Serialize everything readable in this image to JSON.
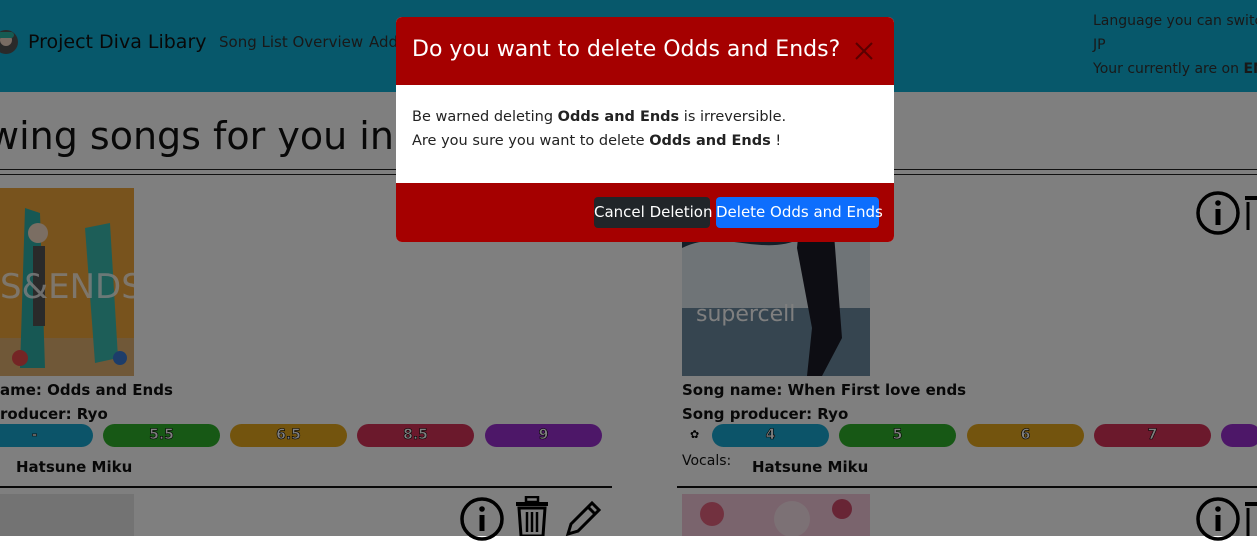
{
  "navbar": {
    "brand": "Project Diva Libary",
    "links": [
      "Song List Overview",
      "Add"
    ],
    "language": {
      "line1": "Language you can switc",
      "line2": "JP",
      "line3_prefix": "Your currently are on ",
      "line3_value": "EN"
    }
  },
  "page": {
    "heading": "wing songs for you in th"
  },
  "songs": [
    {
      "name_label": "ame: Odds and Ends",
      "producer_label": "roducer: Ryo",
      "difficulties": [
        "-",
        "5.5",
        "6.5",
        "8.5",
        "9"
      ],
      "vocals_label": "",
      "vocalist": "Hatsune Miku",
      "colors": [
        "#18a9d3",
        "#2fb02a",
        "#e6a91c",
        "#d63359",
        "#9b2fd0"
      ]
    },
    {
      "name_label": "Song name: When First love ends",
      "producer_label": "Song producer: Ryo",
      "star": "✿",
      "difficulties": [
        "4",
        "5",
        "6",
        "7",
        ""
      ],
      "vocals_label": "Vocals:",
      "vocalist": "Hatsune Miku",
      "cover_text": "supercell",
      "colors": [
        "#18a9d3",
        "#2fb02a",
        "#e6a91c",
        "#d63359",
        "#9b2fd0"
      ]
    }
  ],
  "modal": {
    "title": "Do you want to delete Odds and Ends?",
    "body": {
      "l1_pre": "Be warned deleting ",
      "l1_bold": "Odds and Ends",
      "l1_post": " is irreversible.",
      "l2_pre": "Are you sure you want to delete ",
      "l2_bold": "Odds and Ends",
      "l2_post": " !"
    },
    "cancel_label": "Cancel Deletion",
    "delete_label": "Delete Odds and Ends"
  },
  "colors": {
    "navbar": "#0fb0d6",
    "modal_red": "#a50000",
    "primary": "#0d6efd",
    "dark": "#212529"
  }
}
